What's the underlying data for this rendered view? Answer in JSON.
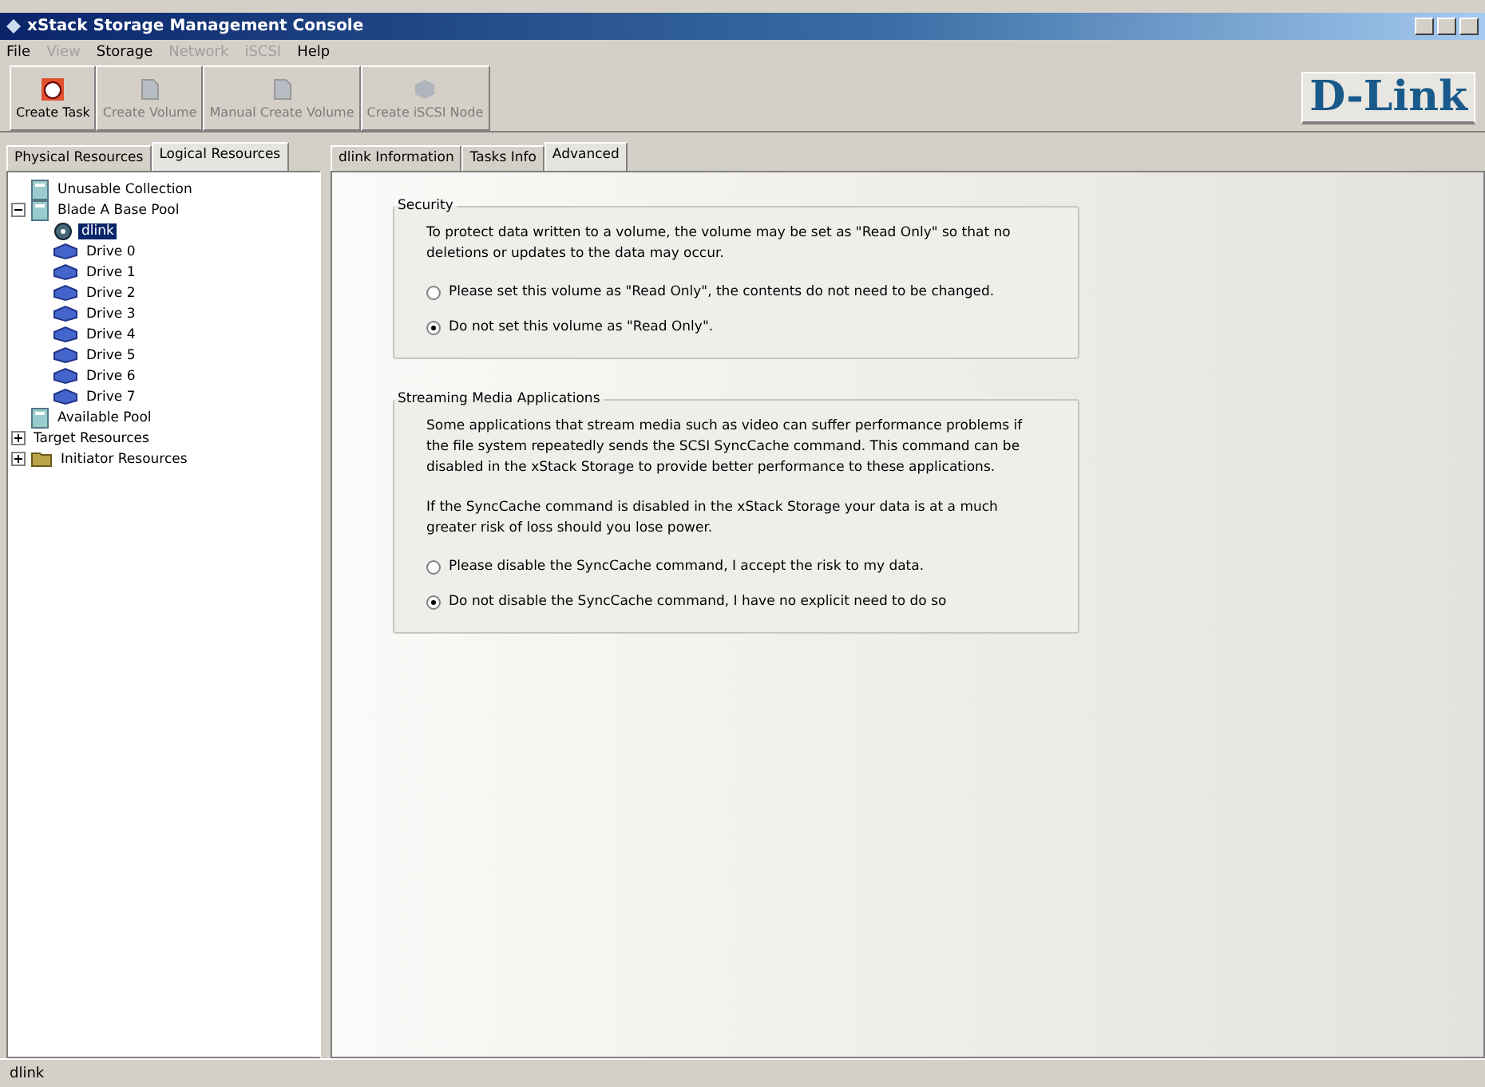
{
  "window": {
    "title": "xStack Storage Management Console"
  },
  "menu": [
    {
      "label": "File",
      "disabled": false
    },
    {
      "label": "View",
      "disabled": true
    },
    {
      "label": "Storage",
      "disabled": false
    },
    {
      "label": "Network",
      "disabled": true
    },
    {
      "label": "iSCSI",
      "disabled": true
    },
    {
      "label": "Help",
      "disabled": false
    }
  ],
  "toolbar": [
    {
      "label": "Create Task",
      "disabled": false,
      "kind": "task"
    },
    {
      "label": "Create Volume",
      "disabled": true,
      "kind": "volume"
    },
    {
      "label": "Manual Create Volume",
      "disabled": true,
      "kind": "volume"
    },
    {
      "label": "Create iSCSI Node",
      "disabled": true,
      "kind": "node"
    }
  ],
  "logo": "D-Link",
  "left_tabs": [
    {
      "label": "Physical Resources",
      "selected": false
    },
    {
      "label": "Logical Resources",
      "selected": true
    }
  ],
  "tree": [
    {
      "label": "Unusable Collection",
      "kind": "pool",
      "selected": false
    },
    {
      "label": "Blade A Base Pool",
      "kind": "pool",
      "selected": false,
      "expanded": true,
      "children": [
        {
          "label": "dlink",
          "kind": "volume",
          "selected": true
        },
        {
          "label": "Drive 0",
          "kind": "drive",
          "selected": false
        },
        {
          "label": "Drive 1",
          "kind": "drive",
          "selected": false
        },
        {
          "label": "Drive 2",
          "kind": "drive",
          "selected": false
        },
        {
          "label": "Drive 3",
          "kind": "drive",
          "selected": false
        },
        {
          "label": "Drive 4",
          "kind": "drive",
          "selected": false
        },
        {
          "label": "Drive 5",
          "kind": "drive",
          "selected": false
        },
        {
          "label": "Drive 6",
          "kind": "drive",
          "selected": false
        },
        {
          "label": "Drive 7",
          "kind": "drive",
          "selected": false
        }
      ]
    },
    {
      "label": "Available Pool",
      "kind": "pool",
      "selected": false
    },
    {
      "label": "Target Resources",
      "kind": "none",
      "selected": false,
      "expanded": false
    },
    {
      "label": "Initiator Resources",
      "kind": "folder",
      "selected": false,
      "expanded": false
    }
  ],
  "right_tabs": [
    {
      "label": "dlink Information",
      "selected": false
    },
    {
      "label": "Tasks Info",
      "selected": false
    },
    {
      "label": "Advanced",
      "selected": true
    }
  ],
  "groups": [
    {
      "title": "Security",
      "paragraphs": [
        "To protect data written to a volume, the volume may be set as \"Read Only\" so that no deletions or updates to the data may occur."
      ],
      "options": [
        {
          "label": "Please set this volume as \"Read Only\", the contents do not need to be changed.",
          "selected": false
        },
        {
          "label": "Do not set this volume as \"Read Only\".",
          "selected": true
        }
      ]
    },
    {
      "title": "Streaming Media Applications",
      "paragraphs": [
        "Some applications that stream media such as video can suffer performance problems if the file system repeatedly sends the SCSI SyncCache command.  This command can be disabled in the xStack Storage to provide better performance to these applications.",
        "If the SyncCache command is disabled in the xStack Storage your data is at a much greater risk of loss should you lose power."
      ],
      "options": [
        {
          "label": "Please disable the SyncCache command,  I accept the risk to my data.",
          "selected": false
        },
        {
          "label": "Do not disable the SyncCache command, I have no explicit need to do so",
          "selected": true
        }
      ]
    }
  ],
  "status_bar": "dlink"
}
